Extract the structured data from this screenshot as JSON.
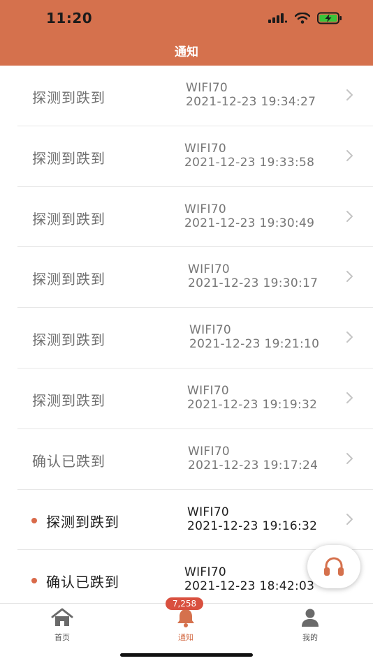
{
  "status_bar": {
    "time": "11:20"
  },
  "header": {
    "title": "通知"
  },
  "notifications": [
    {
      "title": "探测到跌到",
      "device": "WIFI70",
      "time": "2021-12-23 19:34:27",
      "unread": false
    },
    {
      "title": "探测到跌到",
      "device": "WIFI70",
      "time": "2021-12-23 19:33:58",
      "unread": false
    },
    {
      "title": "探测到跌到",
      "device": "WIFI70",
      "time": "2021-12-23 19:30:49",
      "unread": false
    },
    {
      "title": "探测到跌到",
      "device": "WIFI70",
      "time": "2021-12-23 19:30:17",
      "unread": false
    },
    {
      "title": "探测到跌到",
      "device": "WIFI70",
      "time": "2021-12-23 19:21:10",
      "unread": false
    },
    {
      "title": "探测到跌到",
      "device": "WIFI70",
      "time": "2021-12-23 19:19:32",
      "unread": false
    },
    {
      "title": "确认已跌到",
      "device": "WIFI70",
      "time": "2021-12-23 19:17:24",
      "unread": false
    },
    {
      "title": "探测到跌到",
      "device": "WIFI70",
      "time": "2021-12-23 19:16:32",
      "unread": true
    },
    {
      "title": "确认已跌到",
      "device": "WIFI70",
      "time": "2021-12-23 18:42:03",
      "unread": true
    }
  ],
  "tabbar": {
    "home": {
      "label": "首页",
      "icon": "home-icon"
    },
    "notify": {
      "label": "通知",
      "icon": "bell-icon",
      "badge": "7,258"
    },
    "mine": {
      "label": "我的",
      "icon": "person-icon"
    }
  },
  "support_button": {
    "icon": "headphones-icon"
  },
  "colors": {
    "accent": "#d5714d",
    "badge": "#d9503f",
    "unread_dot": "#d96a4a"
  }
}
